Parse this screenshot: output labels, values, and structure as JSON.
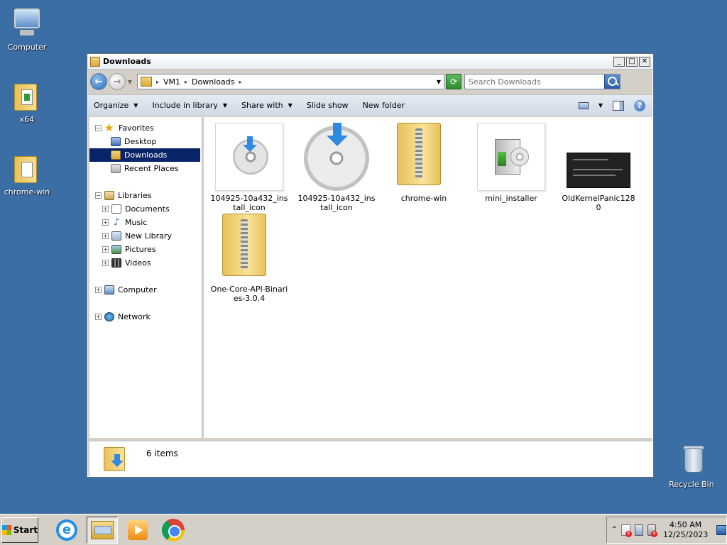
{
  "desktop": {
    "icons": [
      {
        "label": "Computer"
      },
      {
        "label": "x64"
      },
      {
        "label": "chrome-win"
      },
      {
        "label": "Recycle Bin"
      }
    ]
  },
  "window": {
    "title": "Downloads",
    "address": {
      "crumbs": [
        "VM1",
        "Downloads"
      ]
    },
    "search": {
      "placeholder": "Search Downloads"
    },
    "toolbar": {
      "organize": "Organize",
      "include_in_library": "Include in library",
      "share_with": "Share with",
      "slide_show": "Slide show",
      "new_folder": "New folder"
    },
    "nav": {
      "favorites": "Favorites",
      "desktop": "Desktop",
      "downloads": "Downloads",
      "recent_places": "Recent Places",
      "libraries": "Libraries",
      "documents": "Documents",
      "music": "Music",
      "new_library": "New Library",
      "pictures": "Pictures",
      "videos": "Videos",
      "computer": "Computer",
      "network": "Network"
    },
    "files": [
      {
        "name": "104925-10a432_install_icon"
      },
      {
        "name": "104925-10a432_install_icon"
      },
      {
        "name": "chrome-win"
      },
      {
        "name": "mini_installer"
      },
      {
        "name": "OldKernelPanic1280"
      },
      {
        "name": "One-Core-API-Binaries-3.0.4"
      }
    ],
    "status": {
      "count_text": "6 items"
    }
  },
  "taskbar": {
    "start_label": "Start",
    "clock": {
      "time": "4:50 AM",
      "date": "12/25/2023"
    }
  }
}
